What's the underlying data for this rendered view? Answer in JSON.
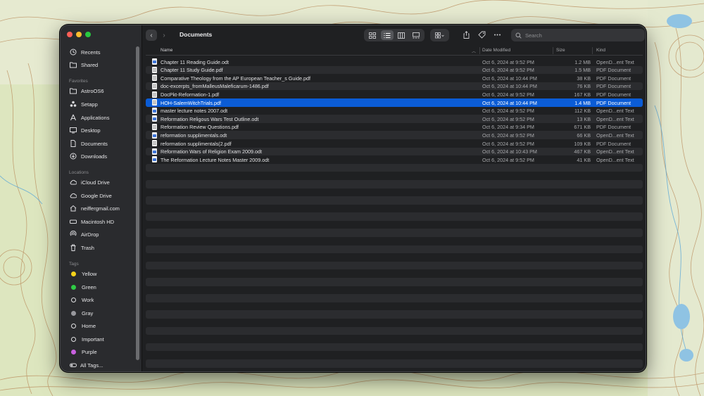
{
  "window": {
    "title": "Documents"
  },
  "toolbar": {
    "search_placeholder": "Search"
  },
  "sidebar": {
    "top_items": [
      {
        "label": "Recents",
        "icon": "clock-icon"
      },
      {
        "label": "Shared",
        "icon": "shared-folder-icon"
      }
    ],
    "favorites_heading": "Favorites",
    "favorites": [
      {
        "label": "AstroOS6",
        "icon": "folder-icon"
      },
      {
        "label": "Setapp",
        "icon": "setapp-icon"
      },
      {
        "label": "Applications",
        "icon": "applications-icon"
      },
      {
        "label": "Desktop",
        "icon": "desktop-icon"
      },
      {
        "label": "Documents",
        "icon": "document-icon"
      },
      {
        "label": "Downloads",
        "icon": "download-icon"
      }
    ],
    "locations_heading": "Locations",
    "locations": [
      {
        "label": "iCloud Drive",
        "icon": "cloud-icon"
      },
      {
        "label": "Google Drive",
        "icon": "cloud-icon"
      },
      {
        "label": "neiffergmail.com",
        "icon": "network-icon"
      },
      {
        "label": "Macintosh HD",
        "icon": "disk-icon"
      },
      {
        "label": "AirDrop",
        "icon": "airdrop-icon"
      },
      {
        "label": "Trash",
        "icon": "trash-icon"
      }
    ],
    "tags_heading": "Tags",
    "tags": [
      {
        "label": "Yellow",
        "color": "#f6d31a",
        "style": "dot"
      },
      {
        "label": "Green",
        "color": "#2fcb45",
        "style": "dot"
      },
      {
        "label": "Work",
        "color": "",
        "style": "ring"
      },
      {
        "label": "Gray",
        "color": "#98989d",
        "style": "dot"
      },
      {
        "label": "Home",
        "color": "",
        "style": "ring"
      },
      {
        "label": "Important",
        "color": "",
        "style": "ring"
      },
      {
        "label": "Purple",
        "color": "#c860df",
        "style": "dot"
      },
      {
        "label": "All Tags...",
        "color": "",
        "style": "all"
      }
    ]
  },
  "columns": {
    "name": "Name",
    "date": "Date Modified",
    "size": "Size",
    "kind": "Kind"
  },
  "files": [
    {
      "name": "Chapter 11 Reading Guide.odt",
      "date": "Oct 6, 2024 at 9:52 PM",
      "size": "1.2 MB",
      "kind": "OpenD...ent Text",
      "type": "odt"
    },
    {
      "name": "Chapter 11 Study Guide.pdf",
      "date": "Oct 6, 2024 at 9:52 PM",
      "size": "1.5 MB",
      "kind": "PDF Document",
      "type": "pdf"
    },
    {
      "name": "Comparative Theology from the AP European Teacher_s Guide.pdf",
      "date": "Oct 6, 2024 at 10:44 PM",
      "size": "38 KB",
      "kind": "PDF Document",
      "type": "pdf"
    },
    {
      "name": "doc-excerpts_fromMalleusMaleficarum-1486.pdf",
      "date": "Oct 6, 2024 at 10:44 PM",
      "size": "76 KB",
      "kind": "PDF Document",
      "type": "pdf"
    },
    {
      "name": "DocPkt-Reformation-1.pdf",
      "date": "Oct 6, 2024 at 9:52 PM",
      "size": "167 KB",
      "kind": "PDF Document",
      "type": "pdf"
    },
    {
      "name": "HOH-SalemWitchTrials.pdf",
      "date": "Oct 6, 2024 at 10:44 PM",
      "size": "1.4 MB",
      "kind": "PDF Document",
      "type": "pdf",
      "selected": true
    },
    {
      "name": "master lecture notes 2007.odt",
      "date": "Oct 6, 2024 at 9:52 PM",
      "size": "112 KB",
      "kind": "OpenD...ent Text",
      "type": "odt"
    },
    {
      "name": "Reformation Religous Wars Test Outline.odt",
      "date": "Oct 6, 2024 at 9:52 PM",
      "size": "13 KB",
      "kind": "OpenD...ent Text",
      "type": "odt"
    },
    {
      "name": "Reformation Review Questions.pdf",
      "date": "Oct 6, 2024 at 9:34 PM",
      "size": "671 KB",
      "kind": "PDF Document",
      "type": "pdf"
    },
    {
      "name": "reformation supplimentals.odt",
      "date": "Oct 6, 2024 at 9:52 PM",
      "size": "66 KB",
      "kind": "OpenD...ent Text",
      "type": "odt"
    },
    {
      "name": "reformation supplimentals(2.pdf",
      "date": "Oct 6, 2024 at 9:52 PM",
      "size": "109 KB",
      "kind": "PDF Document",
      "type": "pdf"
    },
    {
      "name": "Reformation Wars of Religion Exam 2009.odt",
      "date": "Oct 6, 2024 at 10:43 PM",
      "size": "467 KB",
      "kind": "OpenD...ent Text",
      "type": "odt"
    },
    {
      "name": "The Reformation Lecture Notes Master 2009.odt",
      "date": "Oct 6, 2024 at 9:52 PM",
      "size": "41 KB",
      "kind": "OpenD...ent Text",
      "type": "odt"
    }
  ],
  "colors": {
    "selection": "#0b5cd6",
    "window_bg": "#1f2022",
    "sidebar_bg": "#2a2b2e"
  }
}
